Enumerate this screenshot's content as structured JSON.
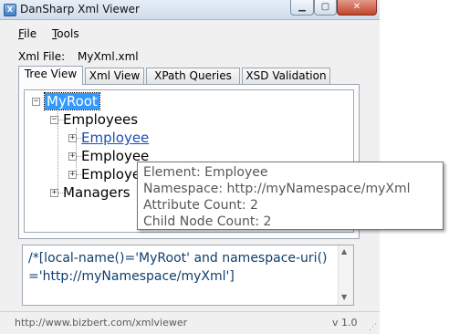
{
  "window": {
    "title": "DanSharp Xml Viewer",
    "icon": "xml-app-icon"
  },
  "titlebar_buttons": {
    "minimize": "▁",
    "maximize": "▢",
    "close": "✕"
  },
  "menu": [
    {
      "accel": "F",
      "rest": "ile"
    },
    {
      "accel": "T",
      "rest": "ools"
    }
  ],
  "xml_file": {
    "label": "Xml File:",
    "value": "MyXml.xml"
  },
  "tabs": [
    {
      "label": "Tree View",
      "active": true
    },
    {
      "label": "Xml View",
      "active": false
    },
    {
      "label": "XPath Queries",
      "active": false
    },
    {
      "label": "XSD Validation",
      "active": false
    }
  ],
  "tree": {
    "root": {
      "label": "MyRoot",
      "expander": "−"
    },
    "employees": {
      "label": "Employees",
      "expander": "−"
    },
    "employee1": {
      "label": "Employee",
      "expander": "+"
    },
    "employee2": {
      "label": "Employee",
      "expander": "+"
    },
    "employee3": {
      "label": "Employee",
      "expander": "+"
    },
    "managers": {
      "label": "Managers",
      "expander": "+"
    }
  },
  "tooltip": {
    "element": "Element: Employee",
    "namespace": "Namespace: http://myNamespace/myXml",
    "attribute_count": "Attribute Count: 2",
    "child_node_count": "Child Node Count: 2"
  },
  "xpath": "/*[local-name()='MyRoot' and namespace-uri()='http://myNamespace/myXml']",
  "status": {
    "url": "http://www.bizbert.com/xmlviewer",
    "version": "v 1.0"
  },
  "colors": {
    "selection": "#3399ff",
    "link": "#1a4fb5",
    "xpath_text": "#0f3e6e"
  }
}
